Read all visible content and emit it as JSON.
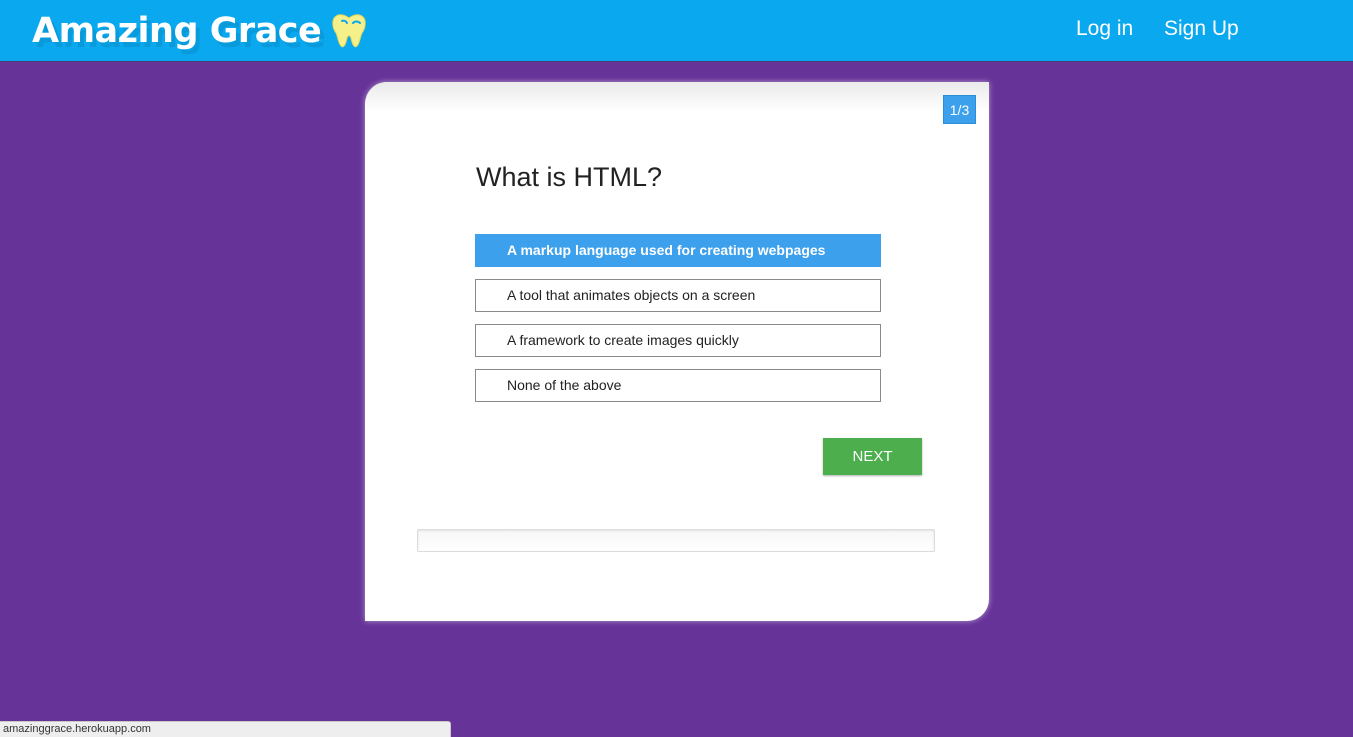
{
  "header": {
    "logo_text": "Amazing Grace",
    "logo_icon": "tooth-icon",
    "nav": {
      "login_label": "Log in",
      "signup_label": "Sign Up"
    }
  },
  "quiz": {
    "counter": "1/3",
    "question": "What is HTML?",
    "options": [
      {
        "label": "A markup language used for creating webpages",
        "selected": true
      },
      {
        "label": "A tool that animates objects on a screen",
        "selected": false
      },
      {
        "label": "A framework to create images quickly",
        "selected": false
      },
      {
        "label": "None of the above",
        "selected": false
      }
    ],
    "next_label": "NEXT",
    "progress": 0
  },
  "statusbar": {
    "url": "amazinggrace.herokuapp.com"
  },
  "colors": {
    "page_background": "#663399",
    "header_background": "#0aa8ef",
    "selected_option": "#3ca0ec",
    "next_button": "#4cae4c",
    "logo_icon": "#f6f08a"
  }
}
